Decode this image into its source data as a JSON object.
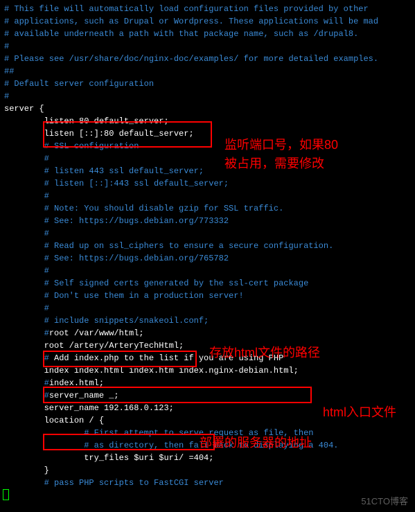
{
  "code": {
    "l1": "# This file will automatically load configuration files provided by other",
    "l2": "# applications, such as Drupal or Wordpress. These applications will be mad",
    "l3": "# available underneath a path with that package name, such as /drupal8.",
    "l4": "#",
    "l5": "# Please see /usr/share/doc/nginx-doc/examples/ for more detailed examples.",
    "l6": "##",
    "l7": "",
    "l8": "# Default server configuration",
    "l9": "#",
    "l10": "server {",
    "l11": "        listen 80 default_server;",
    "l12": "        listen [::]:80 default_server;",
    "l13": "",
    "l14": "        # SSL configuration",
    "l15": "        #",
    "l16": "        # listen 443 ssl default_server;",
    "l17": "        # listen [::]:443 ssl default_server;",
    "l18": "        #",
    "l19": "        # Note: You should disable gzip for SSL traffic.",
    "l20": "        # See: https://bugs.debian.org/773332",
    "l21": "        #",
    "l22": "        # Read up on ssl_ciphers to ensure a secure configuration.",
    "l23": "        # See: https://bugs.debian.org/765782",
    "l24": "        #",
    "l25": "        # Self signed certs generated by the ssl-cert package",
    "l26": "        # Don't use them in a production server!",
    "l27": "        #",
    "l28": "        # include snippets/snakeoil.conf;",
    "l29": "",
    "l30a": "        #",
    "l30b": "root /var/www/html;",
    "l31": "        root /artery/ArteryTechHtml;",
    "l32": "",
    "l33a": "        # ",
    "l33b": "Add index.php to the list if you are using PHP",
    "l34": "        index index.html index.htm index.nginx-debian.html;",
    "l35a": "        #",
    "l35b": "index.html;",
    "l36": "",
    "l37a": "        #",
    "l37b": "server_name _;",
    "l38": "        server_name 192.168.0.123;",
    "l39": "",
    "l40": "        location / {",
    "l41": "                # First attempt to serve request as file, then",
    "l42": "                # as directory, then fall back to displaying a 404.",
    "l43": "                try_files $uri $uri/ =404;",
    "l44": "        }",
    "l45": "",
    "l46": "        # pass PHP scripts to FastCGI server"
  },
  "annotations": {
    "listen": "监听端口号，如果80被占用，需要修改",
    "root": "存放html文件的路径",
    "index": "html入口文件",
    "servername": "部署的服务器的地址"
  },
  "watermark": "51CTO博客"
}
